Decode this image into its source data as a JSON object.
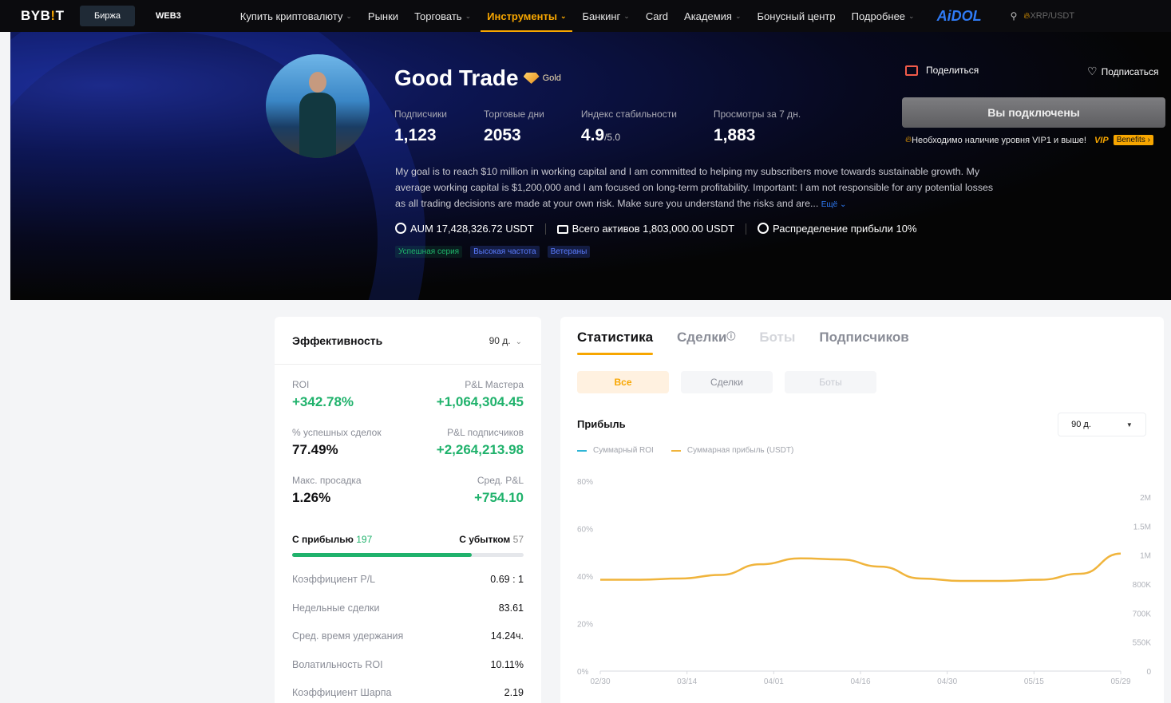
{
  "topbar": {
    "logo": "BYB",
    "logo_dot": "!",
    "logo_end": "T",
    "exchange_pill": "Биржа",
    "web3": "WEB3",
    "nav": [
      {
        "label": "Купить криптовалюту",
        "chevron": true
      },
      {
        "label": "Рынки",
        "chevron": false
      },
      {
        "label": "Торговать",
        "chevron": true
      },
      {
        "label": "Инструменты",
        "chevron": true,
        "active": true
      },
      {
        "label": "Банкинг",
        "chevron": true
      },
      {
        "label": "Card",
        "chevron": false
      },
      {
        "label": "Академия",
        "chevron": true
      },
      {
        "label": "Бонусный центр",
        "chevron": false
      },
      {
        "label": "Подробнее",
        "chevron": true
      }
    ],
    "aidol": "AiDOL",
    "search_text": "XRP/USDT"
  },
  "profile": {
    "name": "Good Trade",
    "badge": "Gold",
    "stats": [
      {
        "label": "Подписчики",
        "value": "1,123",
        "suffix": ""
      },
      {
        "label": "Торговые дни",
        "value": "2053",
        "suffix": ""
      },
      {
        "label": "Индекс стабильности",
        "value": "4.9",
        "suffix": "/5.0"
      },
      {
        "label": "Просмотры за 7 дн.",
        "value": "1,883",
        "suffix": ""
      }
    ],
    "bio": "My goal is to reach $10 million in working capital and I am committed to helping my subscribers move towards sustainable growth. My average working capital is $1,200,000 and I am focused on long-term profitability. Important: I am not responsible for any potential losses as all trading decisions are made at your own risk. Make sure you understand the risks and are...",
    "bio_more": "Ещё",
    "aum": "AUM 17,428,326.72 USDT",
    "total_assets": "Всего активов 1,803,000.00 USDT",
    "profit_share": "Распределение прибыли 10%",
    "tags": [
      {
        "label": "Успешная серия",
        "style": "green"
      },
      {
        "label": "Высокая частота",
        "style": "blue"
      },
      {
        "label": "Ветераны",
        "style": "blue"
      }
    ],
    "share_label": "Поделиться",
    "subscribe_label": "Подписаться",
    "connected_label": "Вы подключены",
    "vip_note": "Необходимо наличие уровня VIP1 и выше!",
    "vip_label": "VIP",
    "benefits_label": "Benefits"
  },
  "performance": {
    "title": "Эффективность",
    "period": "90 д.",
    "kpis": [
      {
        "label": "ROI",
        "value": "+342.78%",
        "green": true,
        "align": "left"
      },
      {
        "label": "P&L Мастера",
        "value": "+1,064,304.45",
        "green": true,
        "align": "right"
      },
      {
        "label": "% успешных сделок",
        "value": "77.49%",
        "green": false,
        "align": "left"
      },
      {
        "label": "P&L подписчиков",
        "value": "+2,264,213.98",
        "green": true,
        "align": "right"
      },
      {
        "label": "Макс. просадка",
        "value": "1.26%",
        "green": false,
        "align": "left"
      },
      {
        "label": "Сред. P&L",
        "value": "+754.10",
        "green": true,
        "align": "right"
      }
    ],
    "profit_label": "С прибылью",
    "profit_count": "197",
    "loss_label": "С убытком",
    "loss_count": "57",
    "win_fraction": 0.776,
    "metrics": [
      {
        "label": "Коэффициент P/L",
        "value": "0.69 : 1"
      },
      {
        "label": "Недельные сделки",
        "value": "83.61"
      },
      {
        "label": "Сред. время удержания",
        "value": "14.24ч."
      },
      {
        "label": "Волатильность ROI",
        "value": "10.11%"
      },
      {
        "label": "Коэффициент Шарпа",
        "value": "2.19"
      }
    ]
  },
  "stats_panel": {
    "tabs": [
      {
        "label": "Статистика",
        "state": "active"
      },
      {
        "label": "Сделки",
        "state": "normal",
        "info": true
      },
      {
        "label": "Боты",
        "state": "disabled"
      },
      {
        "label": "Подписчиков",
        "state": "normal"
      }
    ],
    "subtabs": [
      {
        "label": "Все",
        "state": "active"
      },
      {
        "label": "Сделки",
        "state": "normal"
      },
      {
        "label": "Боты",
        "state": "disabled"
      }
    ],
    "profit_title": "Прибыль",
    "period": "90 д.",
    "legend": [
      {
        "label": "Суммарный ROI",
        "color": "#2fb5d6"
      },
      {
        "label": "Суммарная прибыль (USDT)",
        "color": "#f0b43c"
      }
    ]
  },
  "chart_data": {
    "type": "line",
    "x": [
      "02/30",
      "03/14",
      "04/01",
      "04/16",
      "04/30",
      "05/15",
      "05/29"
    ],
    "y_left_ticks": [
      "0%",
      "20%",
      "40%",
      "60%",
      "80%"
    ],
    "y_left_range": [
      0,
      80
    ],
    "y_right_ticks": [
      "0",
      "550K",
      "700K",
      "800K",
      "1M",
      "1.5M",
      "2M"
    ],
    "series": [
      {
        "name": "Суммарная прибыль (USDT)",
        "color": "#f0b43c",
        "y": [
          38.5,
          38.5,
          39,
          40.5,
          45,
          47.5,
          47,
          44,
          39,
          38,
          38,
          38.5,
          41,
          49.5
        ]
      }
    ],
    "grid": false
  }
}
